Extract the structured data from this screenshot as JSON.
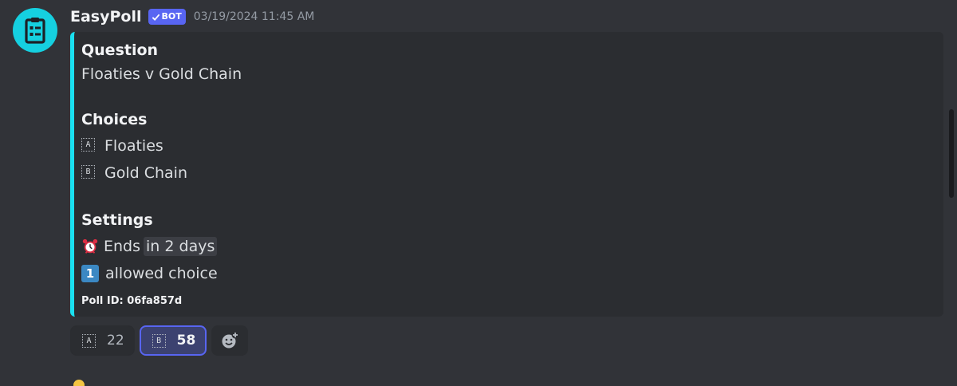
{
  "message": {
    "author": "EasyPoll",
    "bot_badge": "BOT",
    "timestamp": "03/19/2024 11:45 AM",
    "avatar_icon": "clipboard-list-icon",
    "accent_color": "#1ae0f0"
  },
  "embed": {
    "question_label": "Question",
    "question_value": "Floaties v Gold Chain",
    "choices_label": "Choices",
    "choices": [
      {
        "letter": "A",
        "label": "Floaties"
      },
      {
        "letter": "B",
        "label": "Gold Chain"
      }
    ],
    "settings_label": "Settings",
    "ends_prefix": "Ends",
    "ends_value": "in 2 days",
    "allowed_number": "1",
    "allowed_text": "allowed choice",
    "poll_id": "Poll ID: 06fa857d"
  },
  "reactions": [
    {
      "letter": "A",
      "count": "22",
      "active": false
    },
    {
      "letter": "B",
      "count": "58",
      "active": true
    }
  ],
  "add_reaction_icon": "add-reaction-icon"
}
